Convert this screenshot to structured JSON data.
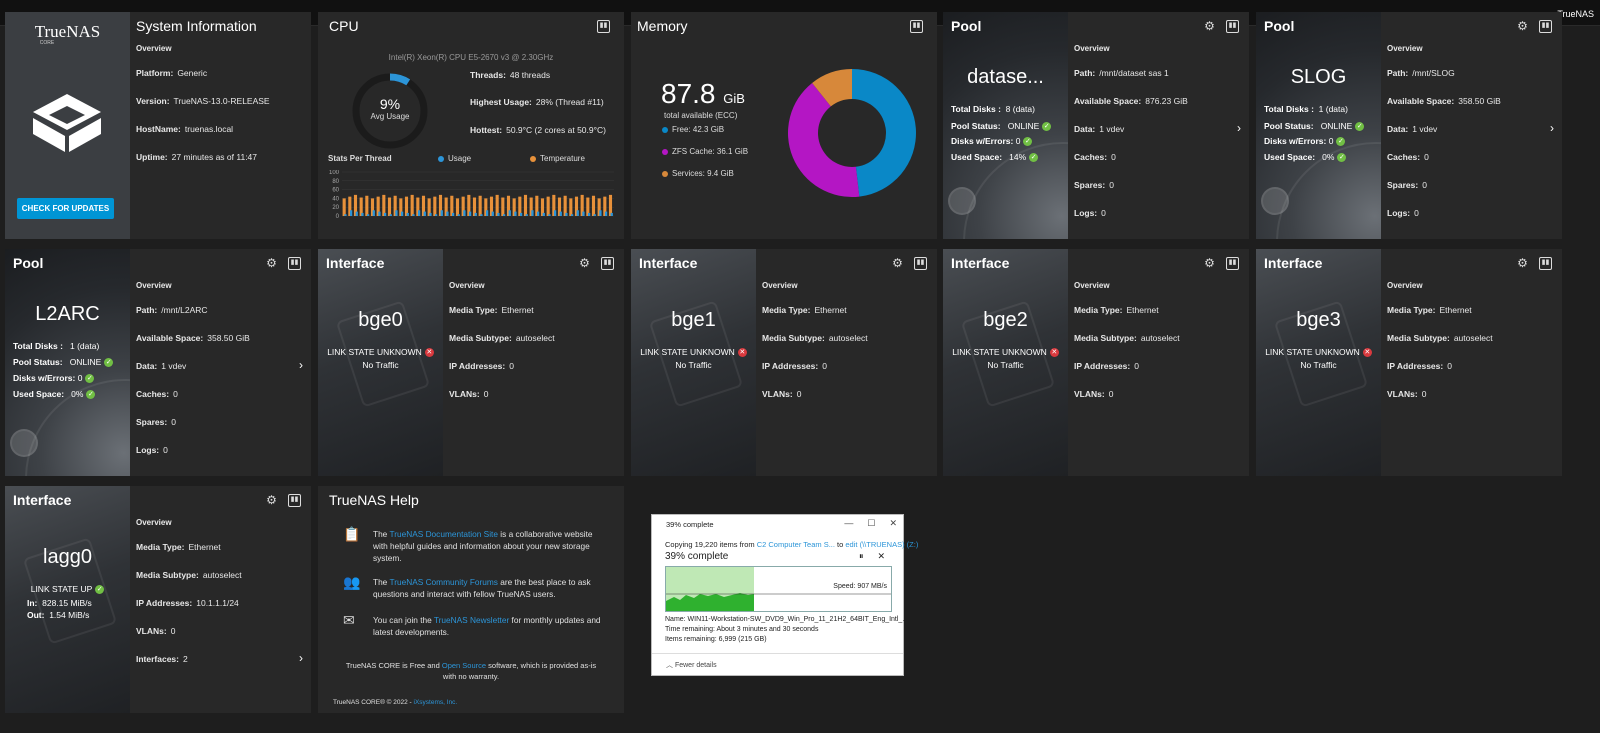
{
  "topbar": {
    "brand": "TrueNAS"
  },
  "sysinfo": {
    "title": "System Information",
    "logo_text": "TrueNAS",
    "logo_sub": "CORE",
    "check_updates": "CHECK FOR UPDATES",
    "overview": "Overview",
    "rows": [
      {
        "label": "Platform:",
        "value": "Generic"
      },
      {
        "label": "Version:",
        "value": "TrueNAS-13.0-RELEASE"
      },
      {
        "label": "HostName:",
        "value": "truenas.local"
      },
      {
        "label": "Uptime:",
        "value": "27 minutes as of 11:47"
      }
    ]
  },
  "cpu": {
    "title": "CPU",
    "model": "Intel(R) Xeon(R) CPU E5-2670 v3 @ 2.30GHz",
    "usage_pct": "9%",
    "usage_value": 9,
    "usage_sub": "Avg Usage",
    "threads_label": "Threads:",
    "threads_value": "48 threads",
    "highest_label": "Highest Usage:",
    "highest_value": "28%  (Thread #11)",
    "hottest_label": "Hottest:",
    "hottest_value": "50.9°C  (2 cores at 50.9°C)",
    "stats_label": "Stats Per Thread",
    "legend_usage": "Usage",
    "legend_temp": "Temperature",
    "usage_color": "#2c95d8",
    "temp_color": "#e8913a",
    "y_ticks": [
      "100",
      "80",
      "60",
      "40",
      "20",
      "0"
    ]
  },
  "memory": {
    "title": "Memory",
    "big_value": "87.8",
    "big_unit": "GiB",
    "sub": "total available (ECC)",
    "legend": [
      {
        "label": "Free: 42.3 GiB",
        "color": "#0a88c7",
        "value": 42.3
      },
      {
        "label": "ZFS Cache: 36.1 GiB",
        "color": "#b416c4",
        "value": 36.1
      },
      {
        "label": "Services: 9.4 GiB",
        "color": "#d7883a",
        "value": 9.4
      }
    ]
  },
  "pool1": {
    "title": "Pool",
    "name": "datase...",
    "total_disks_label": "Total Disks :",
    "total_disks": "8 (data)",
    "status_label": "Pool Status:",
    "status": "ONLINE",
    "errors_label": "Disks w/Errors:",
    "errors": "0",
    "used_label": "Used Space:",
    "used": "14%",
    "overview": "Overview",
    "path_label": "Path:",
    "path": "/mnt/dataset sas 1",
    "avail_label": "Available Space:",
    "avail": "876.23 GiB",
    "data_label": "Data:",
    "data": "1 vdev",
    "caches_label": "Caches:",
    "caches": "0",
    "spares_label": "Spares:",
    "spares": "0",
    "logs_label": "Logs:",
    "logs": "0"
  },
  "pool2": {
    "title": "Pool",
    "name": "SLOG",
    "total_disks_label": "Total Disks :",
    "total_disks": "1 (data)",
    "status_label": "Pool Status:",
    "status": "ONLINE",
    "errors_label": "Disks w/Errors:",
    "errors": "0",
    "used_label": "Used Space:",
    "used": "0%",
    "overview": "Overview",
    "path_label": "Path:",
    "path": "/mnt/SLOG",
    "avail_label": "Available Space:",
    "avail": "358.50 GiB",
    "data_label": "Data:",
    "data": "1 vdev",
    "caches_label": "Caches:",
    "caches": "0",
    "spares_label": "Spares:",
    "spares": "0",
    "logs_label": "Logs:",
    "logs": "0"
  },
  "pool3": {
    "title": "Pool",
    "name": "L2ARC",
    "total_disks_label": "Total Disks :",
    "total_disks": "1 (data)",
    "status_label": "Pool Status:",
    "status": "ONLINE",
    "errors_label": "Disks w/Errors:",
    "errors": "0",
    "used_label": "Used Space:",
    "used": "0%",
    "overview": "Overview",
    "path_label": "Path:",
    "path": "/mnt/L2ARC",
    "avail_label": "Available Space:",
    "avail": "358.50 GiB",
    "data_label": "Data:",
    "data": "1 vdev",
    "caches_label": "Caches:",
    "caches": "0",
    "spares_label": "Spares:",
    "spares": "0",
    "logs_label": "Logs:",
    "logs": "0"
  },
  "interfaces": [
    {
      "title": "Interface",
      "name": "bge0",
      "state": "LINK STATE UNKNOWN",
      "traffic": "No Traffic",
      "overview": "Overview",
      "media_type_label": "Media Type:",
      "media_type": "Ethernet",
      "subtype_label": "Media Subtype:",
      "subtype": "autoselect",
      "ip_label": "IP Addresses:",
      "ip": "0",
      "vlans_label": "VLANs:",
      "vlans": "0"
    },
    {
      "title": "Interface",
      "name": "bge1",
      "state": "LINK STATE UNKNOWN",
      "traffic": "No Traffic",
      "overview": "Overview",
      "media_type_label": "Media Type:",
      "media_type": "Ethernet",
      "subtype_label": "Media Subtype:",
      "subtype": "autoselect",
      "ip_label": "IP Addresses:",
      "ip": "0",
      "vlans_label": "VLANs:",
      "vlans": "0"
    },
    {
      "title": "Interface",
      "name": "bge2",
      "state": "LINK STATE UNKNOWN",
      "traffic": "No Traffic",
      "overview": "Overview",
      "media_type_label": "Media Type:",
      "media_type": "Ethernet",
      "subtype_label": "Media Subtype:",
      "subtype": "autoselect",
      "ip_label": "IP Addresses:",
      "ip": "0",
      "vlans_label": "VLANs:",
      "vlans": "0"
    },
    {
      "title": "Interface",
      "name": "bge3",
      "state": "LINK STATE UNKNOWN",
      "traffic": "No Traffic",
      "overview": "Overview",
      "media_type_label": "Media Type:",
      "media_type": "Ethernet",
      "subtype_label": "Media Subtype:",
      "subtype": "autoselect",
      "ip_label": "IP Addresses:",
      "ip": "0",
      "vlans_label": "VLANs:",
      "vlans": "0"
    }
  ],
  "lagg": {
    "title": "Interface",
    "name": "lagg0",
    "state": "LINK STATE UP",
    "in_label": "In:",
    "in": "828.15 MiB/s",
    "out_label": "Out:",
    "out": "1.54 MiB/s",
    "overview": "Overview",
    "media_type_label": "Media Type:",
    "media_type": "Ethernet",
    "subtype_label": "Media Subtype:",
    "subtype": "autoselect",
    "ip_label": "IP Addresses:",
    "ip": "10.1.1.1/24",
    "vlans_label": "VLANs:",
    "vlans": "0",
    "ifaces_label": "Interfaces:",
    "ifaces": "2"
  },
  "help": {
    "title": "TrueNAS Help",
    "row1_pre": "The ",
    "row1_link": "TrueNAS Documentation Site",
    "row1_post": " is a collaborative website with helpful guides and information about your new storage system.",
    "row2_pre": "The ",
    "row2_link": "TrueNAS Community Forums",
    "row2_post": " are the best place to ask questions and interact with fellow TrueNAS users.",
    "row3_pre": "You can join the ",
    "row3_link": "TrueNAS Newsletter",
    "row3_post": " for monthly updates and latest developments.",
    "free_pre": "TrueNAS CORE is Free and ",
    "free_link": "Open Source",
    "free_post": " software, which is provided as-is with no warranty.",
    "copyright_pre": "TrueNAS CORE® © 2022 - ",
    "copyright_link": "iXsystems, Inc."
  },
  "copy_dialog": {
    "title": "39% complete",
    "copying_pre": "Copying 19,220 items from ",
    "copying_src": "C2 Computer Team S...",
    "copying_mid": " to ",
    "copying_dst": "edit (\\\\TRUENAS) (Z:)",
    "percent": "39% complete",
    "progress": 0.39,
    "speed": "Speed: 907 MB/s",
    "name_line": "Name:  WIN11-Workstation-SW_DVD9_Win_Pro_11_21H2_64BIT_Eng_Intl_...",
    "time_line": "Time remaining:  About 3 minutes and 30 seconds",
    "items_line": "Items remaining:  6,999 (215 GB)",
    "fewer": "Fewer details"
  }
}
